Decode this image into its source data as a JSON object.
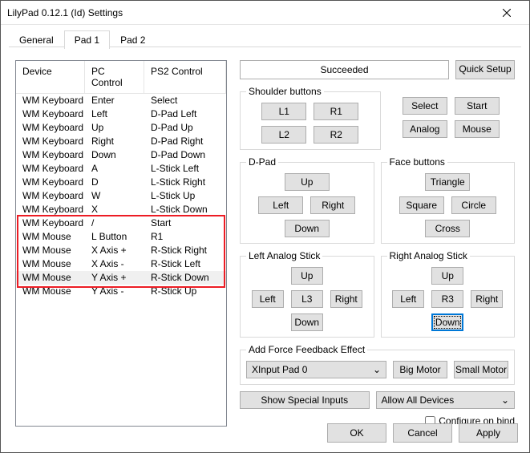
{
  "window": {
    "title": "LilyPad 0.12.1 (Id) Settings"
  },
  "tabs": [
    "General",
    "Pad 1",
    "Pad 2"
  ],
  "active_tab": 1,
  "table": {
    "headers": [
      "Device",
      "PC Control",
      "PS2 Control"
    ],
    "rows": [
      [
        "WM Keyboard",
        "Enter",
        "Select"
      ],
      [
        "WM Keyboard",
        "Left",
        "D-Pad Left"
      ],
      [
        "WM Keyboard",
        "Up",
        "D-Pad Up"
      ],
      [
        "WM Keyboard",
        "Right",
        "D-Pad Right"
      ],
      [
        "WM Keyboard",
        "Down",
        "D-Pad Down"
      ],
      [
        "WM Keyboard",
        "A",
        "L-Stick Left"
      ],
      [
        "WM Keyboard",
        "D",
        "L-Stick Right"
      ],
      [
        "WM Keyboard",
        "W",
        "L-Stick Up"
      ],
      [
        "WM Keyboard",
        "X",
        "L-Stick Down"
      ],
      [
        "WM Keyboard",
        "/",
        "Start"
      ],
      [
        "WM Mouse",
        "L Button",
        "R1"
      ],
      [
        "WM Mouse",
        "X Axis +",
        "R-Stick Right"
      ],
      [
        "WM Mouse",
        "X Axis -",
        "R-Stick Left"
      ],
      [
        "WM Mouse",
        "Y Axis +",
        "R-Stick Down"
      ],
      [
        "WM Mouse",
        "Y Axis -",
        "R-Stick Up"
      ]
    ],
    "selected_row": 13
  },
  "status": "Succeeded",
  "quick_setup": "Quick Setup",
  "groups": {
    "shoulder": {
      "title": "Shoulder buttons",
      "l1": "L1",
      "r1": "R1",
      "l2": "L2",
      "r2": "R2"
    },
    "misc": {
      "select": "Select",
      "start": "Start",
      "analog": "Analog",
      "mouse": "Mouse"
    },
    "dpad": {
      "title": "D-Pad",
      "up": "Up",
      "left": "Left",
      "right": "Right",
      "down": "Down"
    },
    "face": {
      "title": "Face buttons",
      "triangle": "Triangle",
      "square": "Square",
      "circle": "Circle",
      "cross": "Cross"
    },
    "lstick": {
      "title": "Left Analog Stick",
      "up": "Up",
      "left": "Left",
      "l3": "L3",
      "right": "Right",
      "down": "Down"
    },
    "rstick": {
      "title": "Right Analog Stick",
      "up": "Up",
      "left": "Left",
      "r3": "R3",
      "right": "Right",
      "down": "Down"
    },
    "ffb": {
      "title": "Add Force Feedback Effect",
      "device": "XInput Pad 0",
      "big": "Big Motor",
      "small": "Small Motor"
    }
  },
  "special_inputs": "Show Special Inputs",
  "device_filter": "Allow All Devices",
  "configure_on_bind": "Configure on bind",
  "footer": {
    "ok": "OK",
    "cancel": "Cancel",
    "apply": "Apply"
  }
}
